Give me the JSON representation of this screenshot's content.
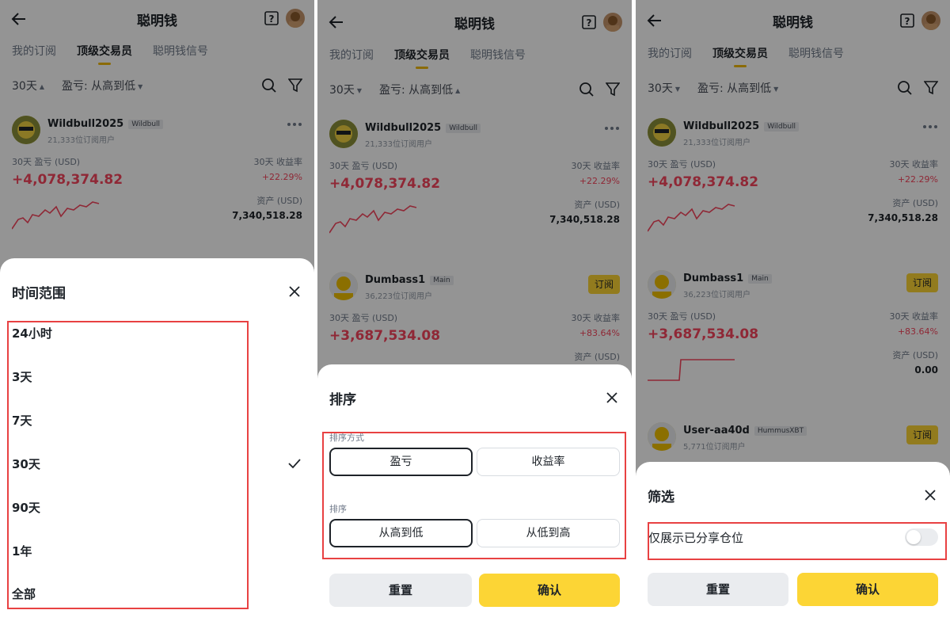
{
  "header": {
    "title": "聪明钱",
    "tabs": [
      "我的订阅",
      "顶级交易员",
      "聪明钱信号"
    ]
  },
  "filters": {
    "range_value": "30天",
    "sort_value": "盈亏: 从高到低"
  },
  "traders": [
    {
      "name": "Wildbull2025",
      "tag": "Wildbull",
      "subscribers": "21,333位订阅用户",
      "pnl_label": "30天 盈亏 (USD)",
      "pnl": "+4,078,374.82",
      "roi_label": "30天 收益率",
      "roi": "+22.29%",
      "asset_label": "资产 (USD)",
      "asset": "7,340,518.28"
    },
    {
      "name": "Dumbass1",
      "tag": "Main",
      "subscribers": "36,223位订阅用户",
      "pnl_label": "30天 盈亏 (USD)",
      "pnl": "+3,687,534.08",
      "roi_label": "30天 收益率",
      "roi": "+83.64%",
      "asset_label": "资产 (USD)",
      "asset": "0.00",
      "follow_label": "订阅"
    },
    {
      "name": "User-aa40d",
      "tag": "HummusXBT",
      "subscribers": "5,771位订阅用户",
      "follow_label": "订阅"
    }
  ],
  "time_sheet": {
    "title": "时间范围",
    "options": [
      "24小时",
      "3天",
      "7天",
      "30天",
      "90天",
      "1年",
      "全部"
    ],
    "selected": "30天"
  },
  "sort_sheet": {
    "title": "排序",
    "method_label": "排序方式",
    "methods": [
      "盈亏",
      "收益率"
    ],
    "selected_method": "盈亏",
    "order_label": "排序",
    "orders": [
      "从高到低",
      "从低到高"
    ],
    "selected_order": "从高到低",
    "reset_label": "重置",
    "confirm_label": "确认"
  },
  "filter_sheet": {
    "title": "筛选",
    "toggle_label": "仅展示已分享仓位",
    "toggle_on": false,
    "reset_label": "重置",
    "confirm_label": "确认"
  },
  "colors": {
    "accent_yellow": "#fcd535",
    "profit_red": "#f6465d",
    "highlight_box": "#e84142"
  }
}
